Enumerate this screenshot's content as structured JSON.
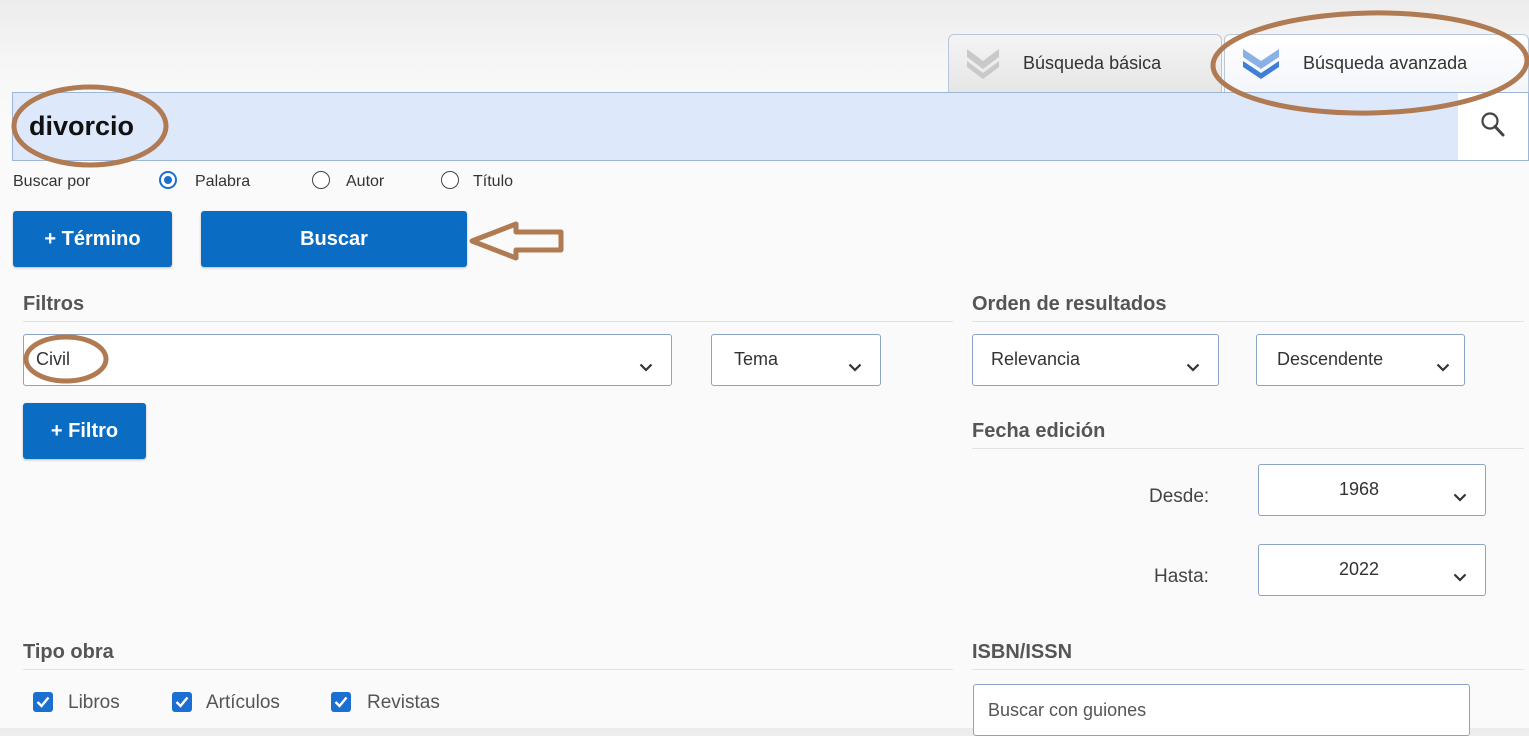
{
  "tabs": {
    "basic": "Búsqueda básica",
    "advanced": "Búsqueda avanzada"
  },
  "search": {
    "value": "divorcio",
    "search_icon": "magnifier-icon"
  },
  "search_by": {
    "label": "Buscar por",
    "options": [
      "Palabra",
      "Autor",
      "Título"
    ],
    "selected": "Palabra"
  },
  "buttons": {
    "add_term": "+ Término",
    "search": "Buscar",
    "add_filter": "+ Filtro"
  },
  "filters": {
    "heading": "Filtros",
    "value": "Civil",
    "field": "Tema"
  },
  "order": {
    "heading": "Orden de resultados",
    "by": "Relevancia",
    "direction": "Descendente"
  },
  "edition_date": {
    "heading": "Fecha edición",
    "from_label": "Desde:",
    "from_value": "1968",
    "to_label": "Hasta:",
    "to_value": "2022"
  },
  "work_type": {
    "heading": "Tipo obra",
    "options": [
      "Libros",
      "Artículos",
      "Revistas"
    ]
  },
  "isbn": {
    "heading": "ISBN/ISSN",
    "placeholder": "Buscar con guiones"
  },
  "colors": {
    "primary": "#0a6cc2",
    "search_bg": "#dde8fb",
    "annotation": "#b07a52"
  }
}
